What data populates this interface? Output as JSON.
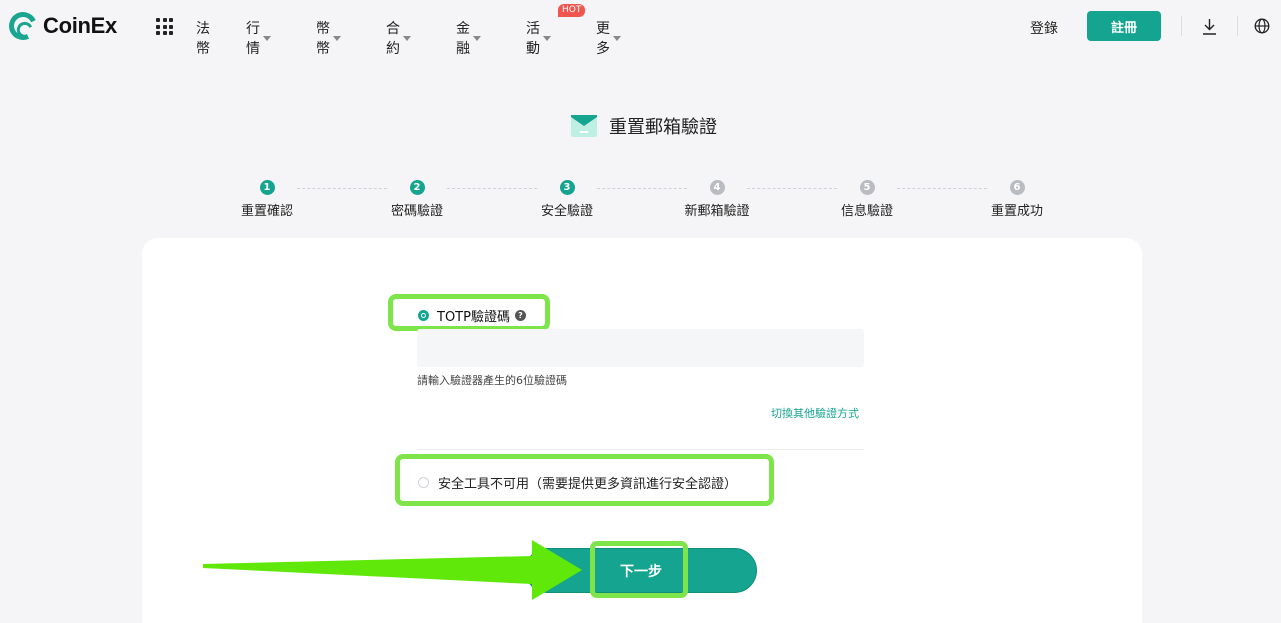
{
  "header": {
    "logo_text": "CoinEx",
    "nav": [
      {
        "label": "法幣",
        "caret": false
      },
      {
        "label": "行情",
        "caret": true
      },
      {
        "label": "幣幣",
        "caret": true
      },
      {
        "label": "合約",
        "caret": true
      },
      {
        "label": "金融",
        "caret": true
      },
      {
        "label": "活動",
        "caret": true,
        "badge": "HOT"
      },
      {
        "label": "更多",
        "caret": true
      }
    ],
    "login_label": "登錄",
    "register_label": "註冊"
  },
  "page": {
    "title": "重置郵箱驗證"
  },
  "steps": [
    {
      "num": "1",
      "label": "重置確認",
      "state": "active"
    },
    {
      "num": "2",
      "label": "密碼驗證",
      "state": "active"
    },
    {
      "num": "3",
      "label": "安全驗證",
      "state": "active"
    },
    {
      "num": "4",
      "label": "新郵箱驗證",
      "state": "inactive"
    },
    {
      "num": "5",
      "label": "信息驗證",
      "state": "inactive"
    },
    {
      "num": "6",
      "label": "重置成功",
      "state": "inactive"
    }
  ],
  "form": {
    "totp_label": "TOTP驗證碼",
    "help_glyph": "?",
    "code_value": "",
    "code_placeholder": "",
    "hint": "請輸入驗證器產生的6位驗證碼",
    "switch_label": "切換其他驗證方式",
    "unavailable_label": "安全工具不可用（需要提供更多資訊進行安全認證）",
    "next_label": "下一步"
  },
  "colors": {
    "accent": "#14a48f",
    "highlight": "#7de449",
    "hot_badge": "#f0564e"
  }
}
